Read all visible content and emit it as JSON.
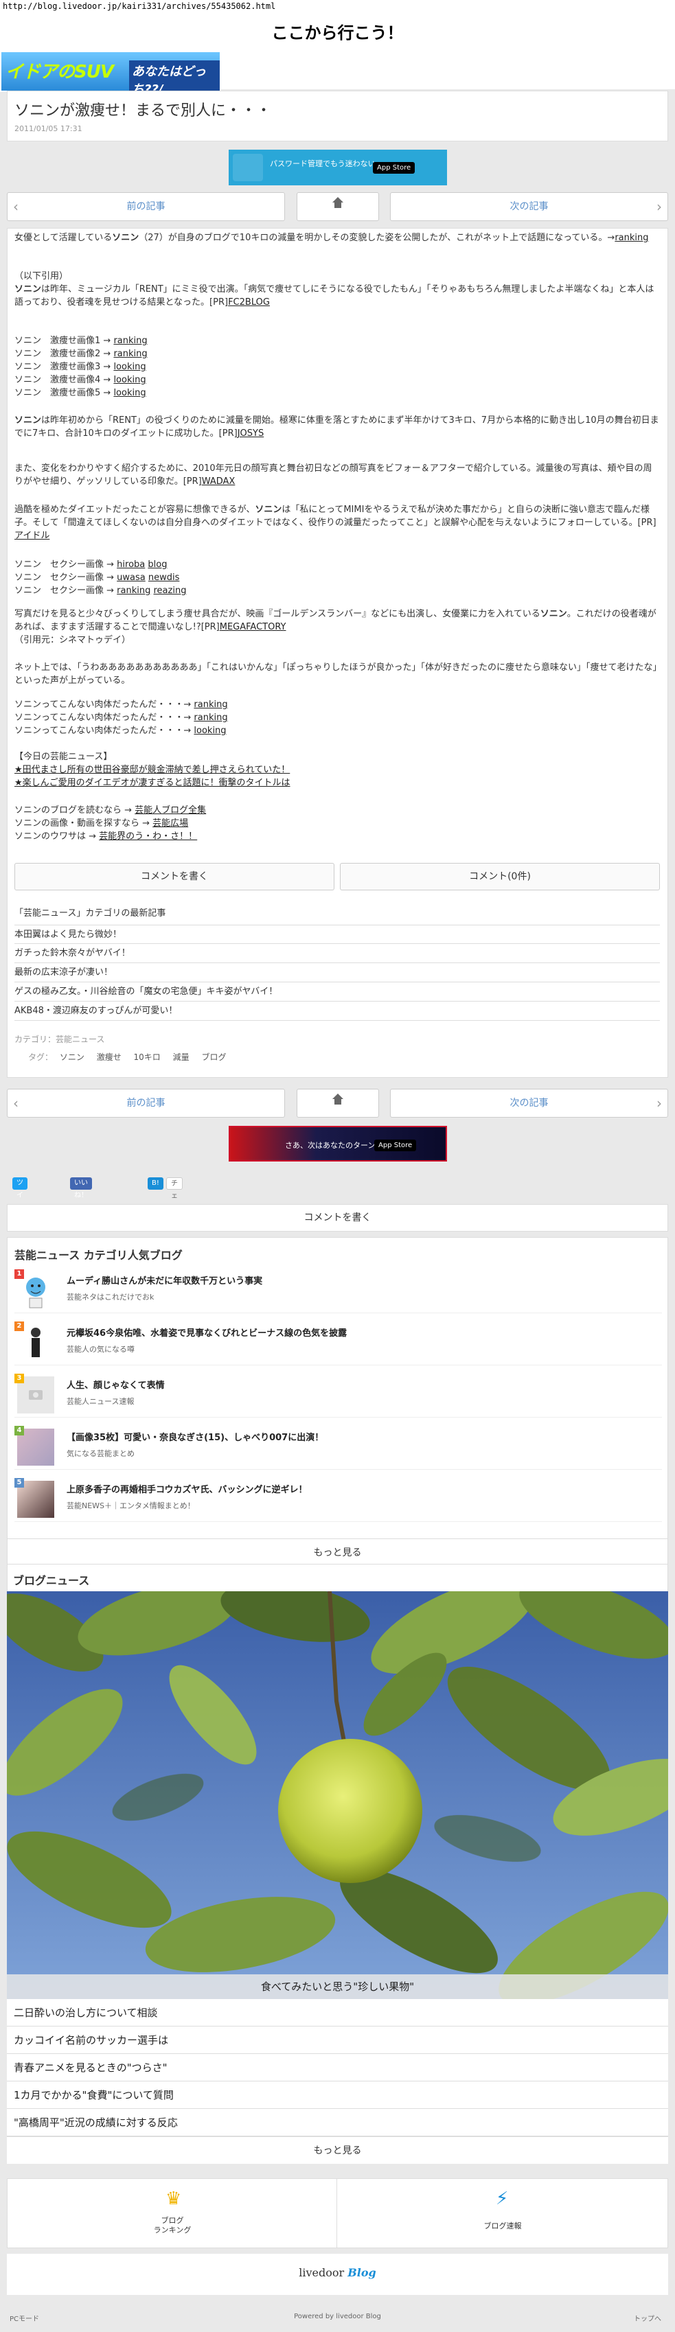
{
  "url": "http://blog.livedoor.jp/kairi331/archives/55435062.html",
  "site_title": "ここから行こう！",
  "banner": {
    "left_text": "イドアのSUV",
    "right_text": "あなたはどっち??/"
  },
  "post": {
    "title": "ソニンが激痩せ！まるで別人に・・・",
    "date": "2011/01/05 17:31"
  },
  "app_banner_top": {
    "text": "パスワード管理でもう迷わない",
    "store": "App Store"
  },
  "app_banner_bottom": {
    "text": "さあ、次はあなたのターン",
    "store": "App Store"
  },
  "nav": {
    "prev": "前の記事",
    "next": "次の記事"
  },
  "body": {
    "p1_a": "女優として活躍している",
    "p1_b": "ソニン",
    "p1_c": "（27）が自身のブログで10キロの減量を明かしその変貌した姿を公開したが、これがネット上で話題になっている。→",
    "p1_link": "ranking",
    "p2_head": "（以下引用）",
    "p2_a": "ソニン",
    "p2_b": "は昨年、ミュージカル「RENT」にミミ役で出演。「病気で痩せてしにそうになる役でしたもん」「そりゃあもちろん無理しましたよ半端なくね」と本人は語っており、役者魂を見せつける結果となった。[PR]",
    "p2_link": "FC2BLOG",
    "list1": [
      {
        "label": "ソニン　激痩せ画像1 → ",
        "link": "ranking"
      },
      {
        "label": "ソニン　激痩せ画像2 → ",
        "link": "ranking"
      },
      {
        "label": "ソニン　激痩せ画像3 → ",
        "link": "looking"
      },
      {
        "label": "ソニン　激痩せ画像4 → ",
        "link": "looking"
      },
      {
        "label": "ソニン　激痩せ画像5 → ",
        "link": "looking"
      }
    ],
    "p3_a": "ソニン",
    "p3_b": "は昨年初めから「RENT」の役づくりのために減量を開始。極寒に体重を落とすためにまず半年かけて3キロ、7月から本格的に動き出し10月の舞台初日までに7キロ、合計10キロのダイエットに成功した。[PR]",
    "p3_link": "JOSYS",
    "p4_a": "また、変化をわかりやすく紹介するために、2010年元日の顔写真と舞台初日などの顔写真をビフォー＆アフターで紹介している。減量後の写真は、頬や目の周りがやせ細り、ゲッソリしている印象だ。[PR]",
    "p4_link": "WADAX",
    "p5_a": "過酷を極めたダイエットだったことが容易に想像できるが、",
    "p5_b": "ソニン",
    "p5_c": "は「私にとってMIMIをやるうえで私が決めた事だから」と自らの決断に強い意志で臨んだ様子。そして「間違えてほしくないのは自分自身へのダイエットではなく、役作りの減量だったってこと」と誤解や心配を与えないようにフォローしている。[PR]",
    "p5_link": "アイドル",
    "list2": [
      {
        "label": "ソニン　セクシー画像 → ",
        "links": [
          "hiroba",
          "blog"
        ]
      },
      {
        "label": "ソニン　セクシー画像 → ",
        "links": [
          "uwasa",
          "newdis"
        ]
      },
      {
        "label": "ソニン　セクシー画像 → ",
        "links": [
          "ranking",
          "reazing"
        ]
      }
    ],
    "p6_a": "写真だけを見ると少々びっくりしてしまう痩せ具合だが、映画『ゴールデンスランバー』などにも出演し、女優業に力を入れている",
    "p6_b": "ソニン",
    "p6_c": "。これだけの役者魂があれば、ますます活躍することで間違いなし!?[PR]",
    "p6_link": "MEGAFACTORY",
    "p6_src": "（引用元：シネマトゥデイ）",
    "p7": "ネット上では、「うわあああああああああああ」「これはいかんな」「ぽっちゃりしたほうが良かった」「体が好きだったのに痩せたら意味ない」「痩せて老けたな」といった声が上がっている。",
    "list3": [
      {
        "label": "ソニンってこんない肉体だったんだ・・・→ ",
        "link": "ranking"
      },
      {
        "label": "ソニンってこんない肉体だったんだ・・・→ ",
        "link": "ranking"
      },
      {
        "label": "ソニンってこんない肉体だったんだ・・・→ ",
        "link": "looking"
      }
    ],
    "today_head": "【今日の芸能ニュース】",
    "today_items": [
      "★田代まさし所有の世田谷豪邸が競金滞納で差し押さえられていた！",
      "★楽しんご愛用のダイエデオが凄すぎると話題に！衝撃のタイトルは"
    ],
    "more_links": [
      {
        "label": "ソニンのブログを読むなら → ",
        "link": "芸能人ブログ全集"
      },
      {
        "label": "ソニンの画像・動画を探すなら → ",
        "link": "芸能広場"
      },
      {
        "label": "ソニンのウワサは → ",
        "link": "芸能界のう・わ・さ！！"
      }
    ]
  },
  "comment_buttons": {
    "write": "コメントを書く",
    "count": "コメント(0件)"
  },
  "category_latest": {
    "heading": "「芸能ニュース」カテゴリの最新記事",
    "items": [
      "本田翼はよく見たら微妙！",
      "ガチった鈴木奈々がヤバイ！",
      "最新の広末涼子が凄い！",
      "ゲスの極み乙女。・川谷絵音の「魔女の宅急便」キキ姿がヤバイ！",
      "AKB48・渡辺麻友のすっぴんが可愛い！"
    ]
  },
  "meta": {
    "category_label": "カテゴリ：",
    "category": "芸能ニュース",
    "tag_label": "タグ：",
    "tags": [
      "ソニン",
      "激痩せ",
      "10キロ",
      "減量",
      "ブログ"
    ]
  },
  "social": {
    "tweet": "ツイート",
    "like": "いいね！ 0",
    "hatena": "B!",
    "check": "チェック"
  },
  "comment_write2": "コメントを書く",
  "ranking": {
    "heading": "芸能ニュース カテゴリ人気ブログ",
    "items": [
      {
        "num": "1",
        "title": "ムーディ勝山さんが未だに年収数千万という事実",
        "src": "芸能ネタはこれだけでおk",
        "color": "#e8413a"
      },
      {
        "num": "2",
        "title": "元欅坂46今泉佑唯、水着姿で見事なくびれとビーナス線の色気を披露",
        "src": "芸能人の気になる噂",
        "color": "#f58220"
      },
      {
        "num": "3",
        "title": "人生、顔じゃなくて表情",
        "src": "芸能人ニュース速報",
        "color": "#f8b500"
      },
      {
        "num": "4",
        "title": "【画像35枚】可愛い・奈良なぎさ(15)、しゃべり007に出演！",
        "src": "気になる芸能まとめ",
        "color": "#7cb342"
      },
      {
        "num": "5",
        "title": "上原多香子の再婚相手コウカズヤ氏、バッシングに逆ギレ！",
        "src": "芸能NEWS＋｜エンタメ情報まとめ！",
        "color": "#5b8fc9"
      }
    ],
    "more": "もっと見る"
  },
  "blog_news": {
    "heading": "ブログニュース",
    "caption": "食べてみたいと思う\"珍しい果物\"",
    "items": [
      "二日酔いの治し方について相談",
      "カッコイイ名前のサッカー選手は",
      "青春アニメを見るときの\"つらさ\"",
      "1カ月でかかる\"食費\"について質問",
      "\"高橋周平\"近況の成績に対する反応"
    ],
    "more": "もっと見る"
  },
  "footer": {
    "rank_label": "ブログ\nランキング",
    "rank_label_1": "ブログ",
    "rank_label_2": "ランキング",
    "speed_label": "ブログ速報",
    "logo_a": "livedoor",
    "logo_b": "Blog",
    "pc_mode": "PCモード",
    "powered": "Powered by livedoor Blog",
    "top": "トップへ"
  }
}
